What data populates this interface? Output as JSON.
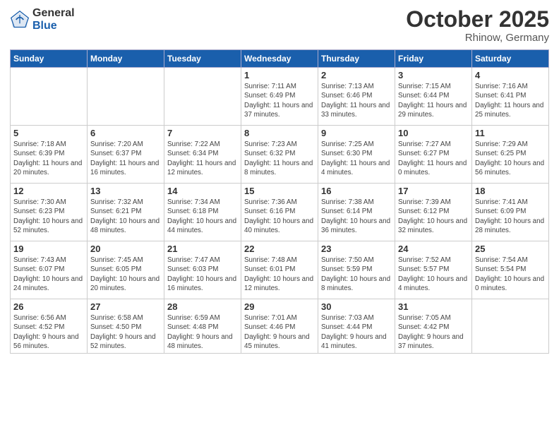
{
  "logo": {
    "general": "General",
    "blue": "Blue"
  },
  "header": {
    "month": "October 2025",
    "location": "Rhinow, Germany"
  },
  "weekdays": [
    "Sunday",
    "Monday",
    "Tuesday",
    "Wednesday",
    "Thursday",
    "Friday",
    "Saturday"
  ],
  "weeks": [
    [
      {
        "day": "",
        "empty": true
      },
      {
        "day": "",
        "empty": true
      },
      {
        "day": "",
        "empty": true
      },
      {
        "day": "1",
        "sunrise": "Sunrise: 7:11 AM",
        "sunset": "Sunset: 6:49 PM",
        "daylight": "Daylight: 11 hours and 37 minutes."
      },
      {
        "day": "2",
        "sunrise": "Sunrise: 7:13 AM",
        "sunset": "Sunset: 6:46 PM",
        "daylight": "Daylight: 11 hours and 33 minutes."
      },
      {
        "day": "3",
        "sunrise": "Sunrise: 7:15 AM",
        "sunset": "Sunset: 6:44 PM",
        "daylight": "Daylight: 11 hours and 29 minutes."
      },
      {
        "day": "4",
        "sunrise": "Sunrise: 7:16 AM",
        "sunset": "Sunset: 6:41 PM",
        "daylight": "Daylight: 11 hours and 25 minutes."
      }
    ],
    [
      {
        "day": "5",
        "sunrise": "Sunrise: 7:18 AM",
        "sunset": "Sunset: 6:39 PM",
        "daylight": "Daylight: 11 hours and 20 minutes."
      },
      {
        "day": "6",
        "sunrise": "Sunrise: 7:20 AM",
        "sunset": "Sunset: 6:37 PM",
        "daylight": "Daylight: 11 hours and 16 minutes."
      },
      {
        "day": "7",
        "sunrise": "Sunrise: 7:22 AM",
        "sunset": "Sunset: 6:34 PM",
        "daylight": "Daylight: 11 hours and 12 minutes."
      },
      {
        "day": "8",
        "sunrise": "Sunrise: 7:23 AM",
        "sunset": "Sunset: 6:32 PM",
        "daylight": "Daylight: 11 hours and 8 minutes."
      },
      {
        "day": "9",
        "sunrise": "Sunrise: 7:25 AM",
        "sunset": "Sunset: 6:30 PM",
        "daylight": "Daylight: 11 hours and 4 minutes."
      },
      {
        "day": "10",
        "sunrise": "Sunrise: 7:27 AM",
        "sunset": "Sunset: 6:27 PM",
        "daylight": "Daylight: 11 hours and 0 minutes."
      },
      {
        "day": "11",
        "sunrise": "Sunrise: 7:29 AM",
        "sunset": "Sunset: 6:25 PM",
        "daylight": "Daylight: 10 hours and 56 minutes."
      }
    ],
    [
      {
        "day": "12",
        "sunrise": "Sunrise: 7:30 AM",
        "sunset": "Sunset: 6:23 PM",
        "daylight": "Daylight: 10 hours and 52 minutes."
      },
      {
        "day": "13",
        "sunrise": "Sunrise: 7:32 AM",
        "sunset": "Sunset: 6:21 PM",
        "daylight": "Daylight: 10 hours and 48 minutes."
      },
      {
        "day": "14",
        "sunrise": "Sunrise: 7:34 AM",
        "sunset": "Sunset: 6:18 PM",
        "daylight": "Daylight: 10 hours and 44 minutes."
      },
      {
        "day": "15",
        "sunrise": "Sunrise: 7:36 AM",
        "sunset": "Sunset: 6:16 PM",
        "daylight": "Daylight: 10 hours and 40 minutes."
      },
      {
        "day": "16",
        "sunrise": "Sunrise: 7:38 AM",
        "sunset": "Sunset: 6:14 PM",
        "daylight": "Daylight: 10 hours and 36 minutes."
      },
      {
        "day": "17",
        "sunrise": "Sunrise: 7:39 AM",
        "sunset": "Sunset: 6:12 PM",
        "daylight": "Daylight: 10 hours and 32 minutes."
      },
      {
        "day": "18",
        "sunrise": "Sunrise: 7:41 AM",
        "sunset": "Sunset: 6:09 PM",
        "daylight": "Daylight: 10 hours and 28 minutes."
      }
    ],
    [
      {
        "day": "19",
        "sunrise": "Sunrise: 7:43 AM",
        "sunset": "Sunset: 6:07 PM",
        "daylight": "Daylight: 10 hours and 24 minutes."
      },
      {
        "day": "20",
        "sunrise": "Sunrise: 7:45 AM",
        "sunset": "Sunset: 6:05 PM",
        "daylight": "Daylight: 10 hours and 20 minutes."
      },
      {
        "day": "21",
        "sunrise": "Sunrise: 7:47 AM",
        "sunset": "Sunset: 6:03 PM",
        "daylight": "Daylight: 10 hours and 16 minutes."
      },
      {
        "day": "22",
        "sunrise": "Sunrise: 7:48 AM",
        "sunset": "Sunset: 6:01 PM",
        "daylight": "Daylight: 10 hours and 12 minutes."
      },
      {
        "day": "23",
        "sunrise": "Sunrise: 7:50 AM",
        "sunset": "Sunset: 5:59 PM",
        "daylight": "Daylight: 10 hours and 8 minutes."
      },
      {
        "day": "24",
        "sunrise": "Sunrise: 7:52 AM",
        "sunset": "Sunset: 5:57 PM",
        "daylight": "Daylight: 10 hours and 4 minutes."
      },
      {
        "day": "25",
        "sunrise": "Sunrise: 7:54 AM",
        "sunset": "Sunset: 5:54 PM",
        "daylight": "Daylight: 10 hours and 0 minutes."
      }
    ],
    [
      {
        "day": "26",
        "sunrise": "Sunrise: 6:56 AM",
        "sunset": "Sunset: 4:52 PM",
        "daylight": "Daylight: 9 hours and 56 minutes."
      },
      {
        "day": "27",
        "sunrise": "Sunrise: 6:58 AM",
        "sunset": "Sunset: 4:50 PM",
        "daylight": "Daylight: 9 hours and 52 minutes."
      },
      {
        "day": "28",
        "sunrise": "Sunrise: 6:59 AM",
        "sunset": "Sunset: 4:48 PM",
        "daylight": "Daylight: 9 hours and 48 minutes."
      },
      {
        "day": "29",
        "sunrise": "Sunrise: 7:01 AM",
        "sunset": "Sunset: 4:46 PM",
        "daylight": "Daylight: 9 hours and 45 minutes."
      },
      {
        "day": "30",
        "sunrise": "Sunrise: 7:03 AM",
        "sunset": "Sunset: 4:44 PM",
        "daylight": "Daylight: 9 hours and 41 minutes."
      },
      {
        "day": "31",
        "sunrise": "Sunrise: 7:05 AM",
        "sunset": "Sunset: 4:42 PM",
        "daylight": "Daylight: 9 hours and 37 minutes."
      },
      {
        "day": "",
        "empty": true
      }
    ]
  ]
}
